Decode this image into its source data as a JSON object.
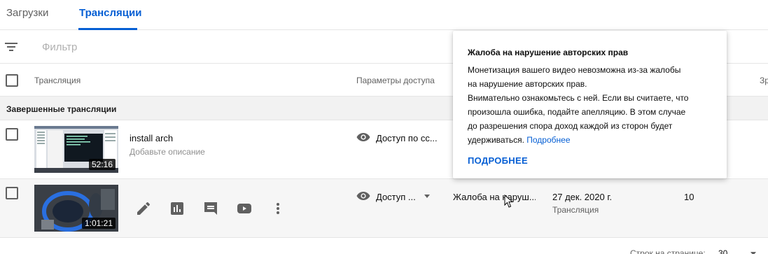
{
  "tabs": [
    "Загрузки",
    "Трансляции"
  ],
  "filter": {
    "placeholder": "Фильтр"
  },
  "table": {
    "headers": [
      "Трансляция",
      "Параметры доступа",
      "Зр"
    ]
  },
  "group": {
    "label": "Завершенные трансляции"
  },
  "rows": [
    {
      "title": "install arch",
      "description": "Добавьте описание",
      "duration": "52:16",
      "visibility": "Доступ по сс...",
      "visibility_icon": "eye-icon"
    },
    {
      "duration": "1:01:21",
      "visibility": "Доступ ...",
      "visibility_icon": "eye-icon",
      "restriction": "Жалоба на наруш...",
      "date": "27 дек. 2020 г.",
      "date_sub": "Трансляция",
      "views": "10",
      "actions": [
        "pencil-icon",
        "analytics-icon",
        "comments-icon",
        "youtube-icon",
        "more-vert-icon"
      ]
    }
  ],
  "tooltip": {
    "title": "Жалоба на нарушение авторских прав",
    "line1": "Монетизация вашего видео невозможна из-за жалобы",
    "line2": "на нарушение авторских прав.",
    "line3": "Внимательно ознакомьтесь с ней. Если вы считаете, что",
    "line4": "произошла ошибка, подайте апелляцию. В этом случае",
    "line5": "до разрешения спора доход каждой из сторон будет",
    "line6": "удерживаться.",
    "link": "Подробнее",
    "button": "ПОДРОБНЕЕ"
  },
  "footer": {
    "rows_per_page_label": "Строк на странице:",
    "rows_per_page": "30"
  },
  "colors": {
    "accent": "#065fd4",
    "text": "#0d0d0d",
    "secondary": "#606060"
  }
}
